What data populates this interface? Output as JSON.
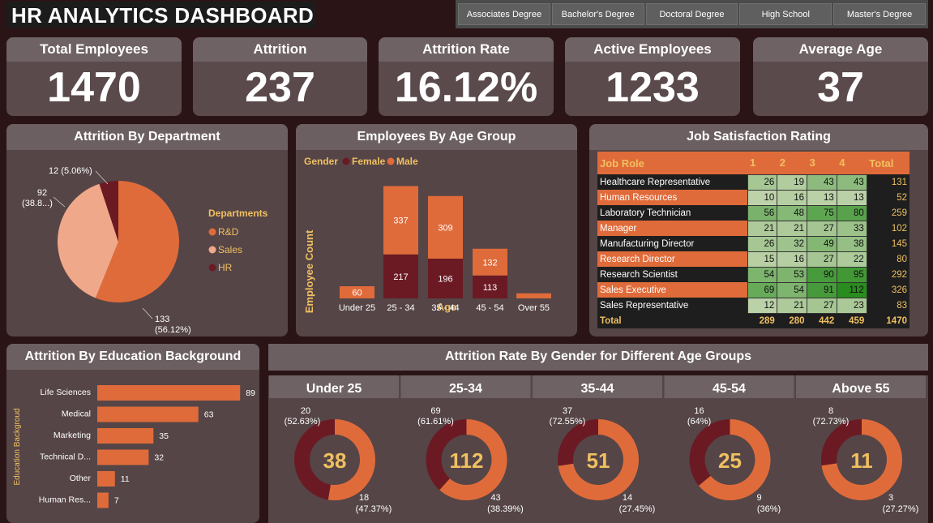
{
  "title": "HR ANALYTICS DASHBOARD",
  "education_filters": [
    "Associates Degree",
    "Bachelor's Degree",
    "Doctoral Degree",
    "High School",
    "Master's Degree"
  ],
  "kpis": [
    {
      "label": "Total Employees",
      "value": "1470"
    },
    {
      "label": "Attrition",
      "value": "237"
    },
    {
      "label": "Attrition Rate",
      "value": "16.12%"
    },
    {
      "label": "Active Employees",
      "value": "1233"
    },
    {
      "label": "Average Age",
      "value": "37"
    }
  ],
  "panels": {
    "dept": "Attrition By Department",
    "age": "Employees By Age Group",
    "jobsat": "Job Satisfaction Rating",
    "edu": "Attrition By Education Background",
    "gender": "Attrition Rate By Gender for Different Age Groups"
  },
  "colors": {
    "orange": "#e06b3a",
    "sales": "#f0a88a",
    "maroon": "#6b1a24",
    "gold": "#f0c060"
  },
  "chart_data": [
    {
      "type": "pie",
      "title": "Attrition By Department",
      "legend_title": "Departments",
      "legend_position": "right",
      "slices": [
        {
          "name": "R&D",
          "value": 133,
          "label": "133",
          "pct": "(56.12%)"
        },
        {
          "name": "Sales",
          "value": 92,
          "label": "92",
          "pct": "(38.8...)"
        },
        {
          "name": "HR",
          "value": 12,
          "label": "12 (5.06%)",
          "pct": ""
        }
      ]
    },
    {
      "type": "bar",
      "title": "Employees By Age Group",
      "stacked": true,
      "legend_title": "Gender",
      "xlabel": "Age",
      "ylabel": "Employee Count",
      "categories": [
        "Under 25",
        "25 - 34",
        "35 - 44",
        "45 - 54",
        "Over 55"
      ],
      "series": [
        {
          "name": "Female",
          "values": [
            0,
            217,
            196,
            113,
            0
          ]
        },
        {
          "name": "Male",
          "values": [
            60,
            337,
            309,
            132,
            0
          ]
        }
      ],
      "data_labels": {
        "Female": [
          "",
          "217",
          "196",
          "113",
          ""
        ],
        "Male": [
          "60",
          "337",
          "309",
          "132",
          ""
        ]
      },
      "over55_total": 25
    },
    {
      "type": "table",
      "title": "Job Satisfaction Rating",
      "columns": [
        "Job Role",
        "1",
        "2",
        "3",
        "4",
        "Total"
      ],
      "rows": [
        [
          "Healthcare Representative",
          "26",
          "19",
          "43",
          "43",
          "131"
        ],
        [
          "Human Resources",
          "10",
          "16",
          "13",
          "13",
          "52"
        ],
        [
          "Laboratory Technician",
          "56",
          "48",
          "75",
          "80",
          "259"
        ],
        [
          "Manager",
          "21",
          "21",
          "27",
          "33",
          "102"
        ],
        [
          "Manufacturing Director",
          "26",
          "32",
          "49",
          "38",
          "145"
        ],
        [
          "Research Director",
          "15",
          "16",
          "27",
          "22",
          "80"
        ],
        [
          "Research Scientist",
          "54",
          "53",
          "90",
          "95",
          "292"
        ],
        [
          "Sales Executive",
          "69",
          "54",
          "91",
          "112",
          "326"
        ],
        [
          "Sales Representative",
          "12",
          "21",
          "27",
          "23",
          "83"
        ]
      ],
      "total_row": [
        "Total",
        "289",
        "280",
        "442",
        "459",
        "1470"
      ]
    },
    {
      "type": "bar",
      "orientation": "horizontal",
      "title": "Attrition By Education Background",
      "ylabel": "Education Backgroud",
      "categories": [
        "Life Sciences",
        "Medical",
        "Marketing",
        "Technical D...",
        "Other",
        "Human Res..."
      ],
      "values": [
        89,
        63,
        35,
        32,
        11,
        7
      ]
    },
    {
      "type": "pie",
      "title": "Attrition Rate By Gender for Different Age Groups",
      "groups": [
        {
          "label": "Under 25",
          "center": "38",
          "male": 18,
          "male_label": [
            "18",
            "(47.37%)"
          ],
          "female": 20,
          "female_label": [
            "20",
            "(52.63%)"
          ]
        },
        {
          "label": "25-34",
          "center": "112",
          "male": 43,
          "male_label": [
            "43",
            "(38.39%)"
          ],
          "female": 69,
          "female_label": [
            "69",
            "(61.61%)"
          ]
        },
        {
          "label": "35-44",
          "center": "51",
          "male": 14,
          "male_label": [
            "14",
            "(27.45%)"
          ],
          "female": 37,
          "female_label": [
            "37",
            "(72.55%)"
          ]
        },
        {
          "label": "45-54",
          "center": "25",
          "male": 9,
          "male_label": [
            "9",
            "(36%)"
          ],
          "female": 16,
          "female_label": [
            "16",
            "(64%)"
          ]
        },
        {
          "label": "Above 55",
          "center": "11",
          "male": 3,
          "male_label": [
            "3",
            "(27.27%)"
          ],
          "female": 8,
          "female_label": [
            "8",
            "(72.73%)"
          ]
        }
      ]
    }
  ]
}
